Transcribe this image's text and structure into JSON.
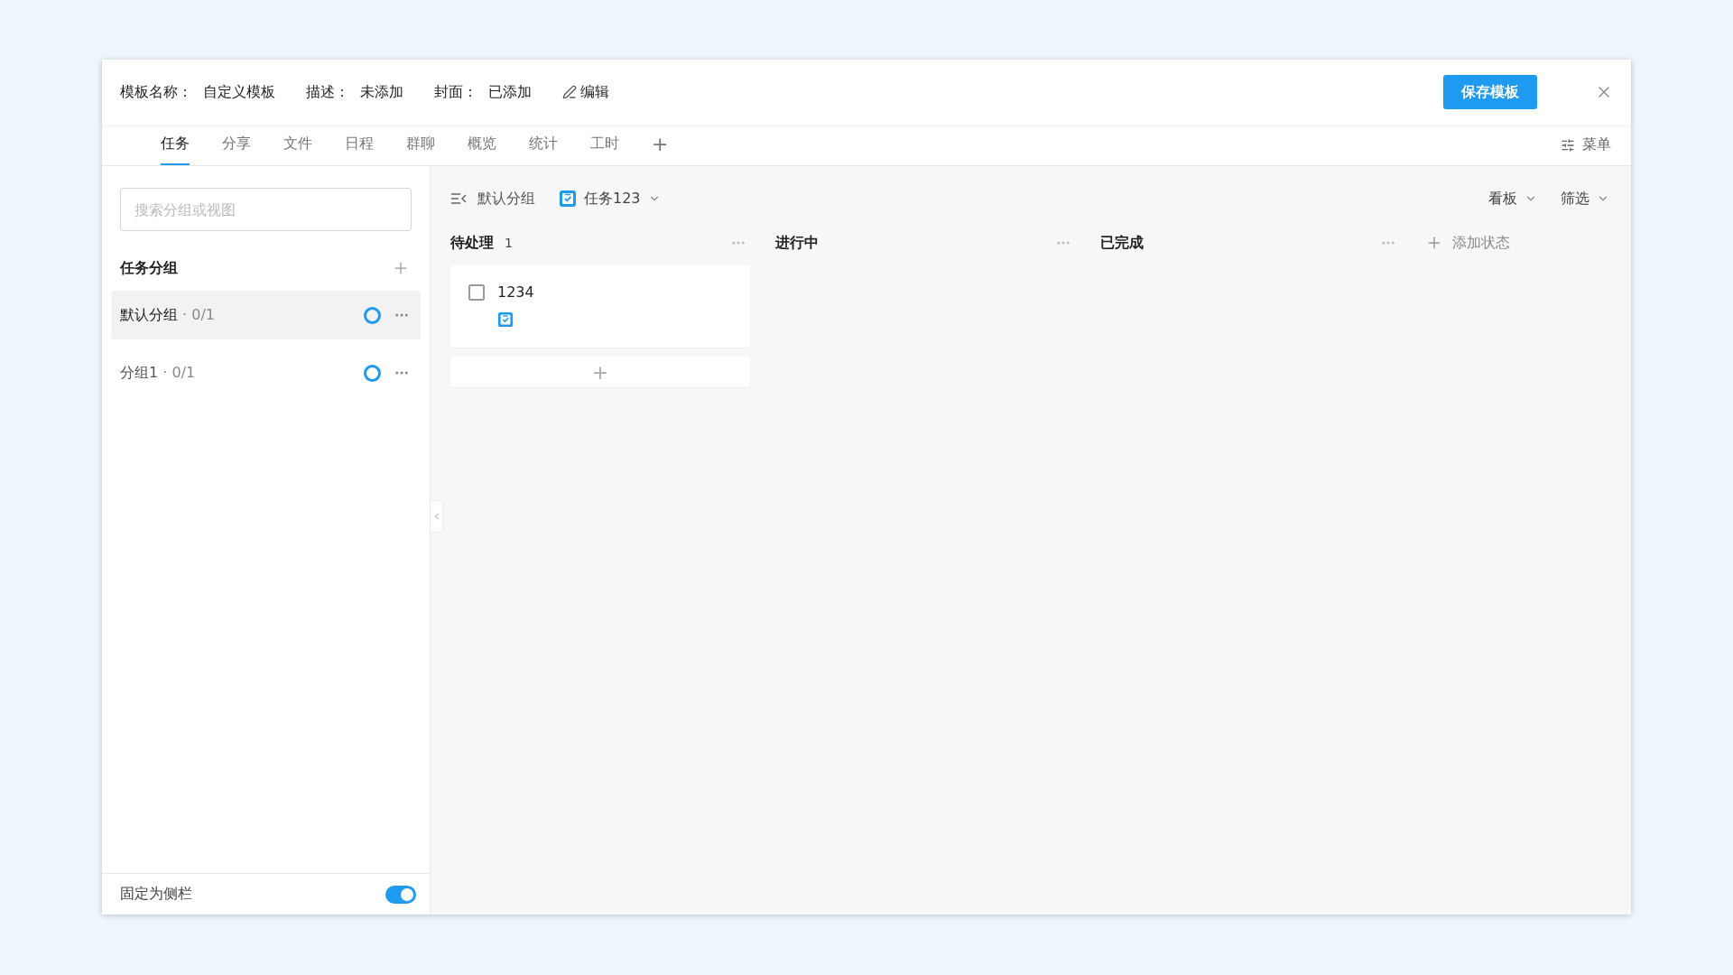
{
  "header": {
    "fields": [
      {
        "label": "模板名称：",
        "value": "自定义模板"
      },
      {
        "label": "描述：",
        "value": "未添加"
      },
      {
        "label": "封面：",
        "value": "已添加"
      }
    ],
    "edit_link": "编辑",
    "save_button": "保存模板"
  },
  "tabs": [
    {
      "label": "任务",
      "selected": true
    },
    {
      "label": "分享",
      "selected": false
    },
    {
      "label": "文件",
      "selected": false
    },
    {
      "label": "日程",
      "selected": false
    },
    {
      "label": "群聊",
      "selected": false
    },
    {
      "label": "概览",
      "selected": false
    },
    {
      "label": "统计",
      "selected": false
    },
    {
      "label": "工时",
      "selected": false
    }
  ],
  "add_tab": "+",
  "menu_button": "菜单",
  "sidebar": {
    "search": {
      "placeholder": "搜索分组或视图"
    },
    "title": "任务分组",
    "items": [
      {
        "name": "默认分组",
        "count": "· 0/1",
        "selected": true
      },
      {
        "name": "分组1",
        "count": "· 0/1",
        "selected": false
      }
    ],
    "pin": {
      "label": "固定为侧栏",
      "on": true
    }
  },
  "board": {
    "breadcrumb": "默认分组",
    "view_name": "任务123",
    "view_mode": "看板",
    "filter": "筛选",
    "columns": [
      {
        "title": "待处理",
        "count": "1",
        "cards": [
          {
            "title": "1234",
            "checked": false
          }
        ],
        "add_card": "+"
      },
      {
        "title": "进行中"
      },
      {
        "title": "已完成"
      }
    ],
    "add_status": "添加状态"
  }
}
